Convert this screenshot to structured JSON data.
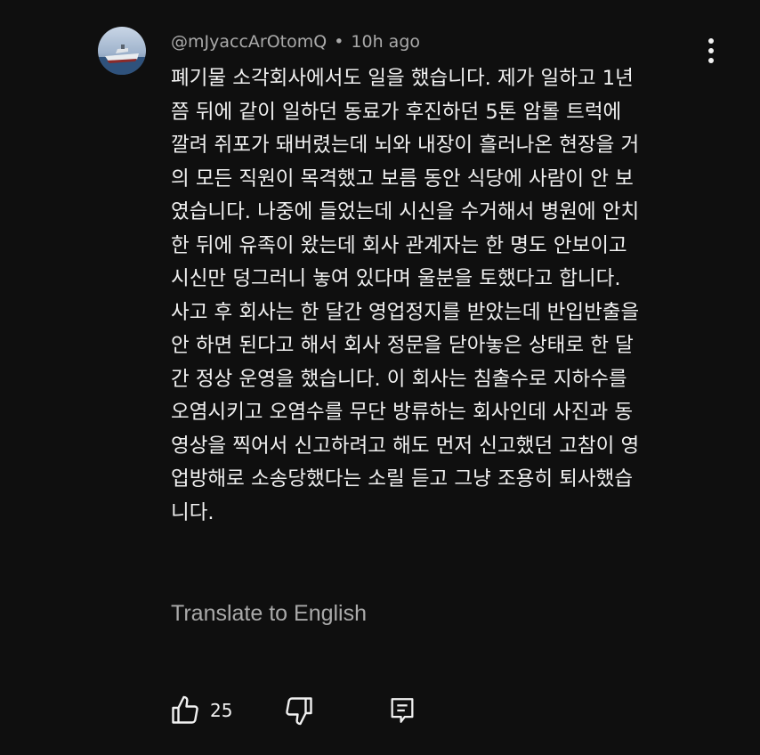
{
  "comment": {
    "author": "@mJyaccArOtomQ",
    "separator": "•",
    "timestamp": "10h ago",
    "text": "폐기물 소각회사에서도 일을 했습니다. 제가 일하고 1년\n쯤 뒤에 같이 일하던 동료가 후진하던 5톤 암롤 트럭에\n깔려 쥐포가 돼버렸는데 뇌와 내장이 흘러나온 현장을 거\n의 모든 직원이 목격했고 보름 동안 식당에 사람이 안 보\n였습니다. 나중에 들었는데 시신을 수거해서 병원에 안치\n한 뒤에 유족이 왔는데 회사 관계자는 한 명도 안보이고\n시신만 덩그러니 놓여 있다며 울분을 토했다고 합니다.\n사고 후 회사는 한 달간 영업정지를 받았는데 반입반출을\n안 하면 된다고 해서 회사 정문을 닫아놓은 상태로 한 달\n간 정상 운영을 했습니다. 이 회사는 침출수로 지하수를\n오염시키고 오염수를 무단 방류하는 회사인데 사진과 동\n영상을 찍어서 신고하려고 해도 먼저 신고했던 고참이 영\n업방해로 소송당했다는 소릴 듣고 그냥 조용히 퇴사했습\n니다.",
    "translate_label": "Translate to English",
    "like_count": "25"
  },
  "icons": {
    "avatar": "ship-avatar",
    "more": "more-vertical-icon",
    "like": "thumbs-up-icon",
    "dislike": "thumbs-down-icon",
    "reply": "reply-comment-icon"
  },
  "colors": {
    "background": "#0f0f0f",
    "primary_text": "#f1f1f1",
    "secondary_text": "#aaaaaa"
  }
}
